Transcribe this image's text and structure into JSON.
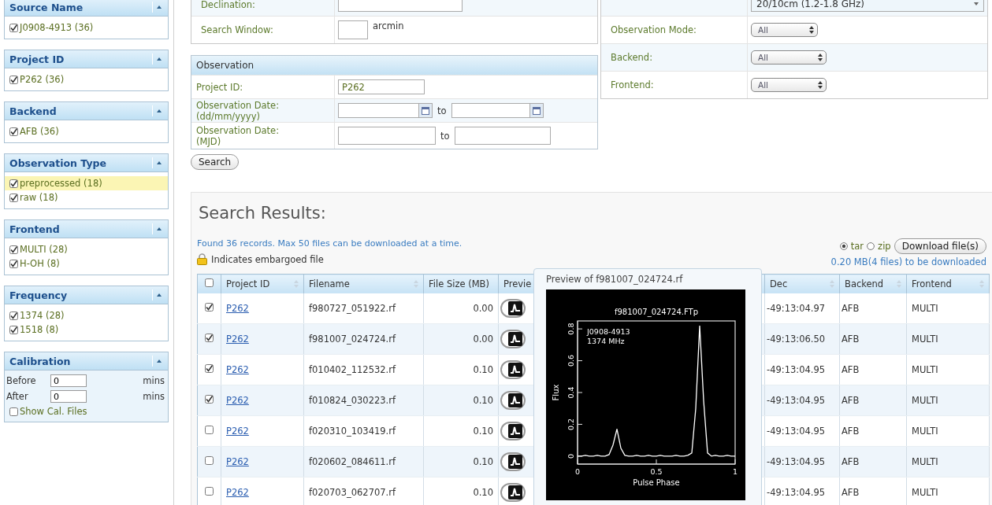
{
  "sidebar": {
    "panels": [
      {
        "title": "Source Name",
        "kind": "checklist",
        "items": [
          {
            "label": "J0908-4913 (36)",
            "checked": true,
            "highlighted": false
          }
        ]
      },
      {
        "title": "Project ID",
        "kind": "checklist",
        "items": [
          {
            "label": "P262 (36)",
            "checked": true,
            "highlighted": false
          }
        ]
      },
      {
        "title": "Backend",
        "kind": "checklist",
        "items": [
          {
            "label": "AFB (36)",
            "checked": true,
            "highlighted": false
          }
        ]
      },
      {
        "title": "Observation Type",
        "kind": "checklist",
        "items": [
          {
            "label": "preprocessed (18)",
            "checked": true,
            "highlighted": true
          },
          {
            "label": "raw (18)",
            "checked": true,
            "highlighted": false
          }
        ]
      },
      {
        "title": "Frontend",
        "kind": "checklist",
        "items": [
          {
            "label": "MULTI (28)",
            "checked": true,
            "highlighted": false
          },
          {
            "label": "H-OH (8)",
            "checked": true,
            "highlighted": false
          }
        ]
      },
      {
        "title": "Frequency",
        "kind": "checklist",
        "items": [
          {
            "label": "1374 (28)",
            "checked": true,
            "highlighted": false
          },
          {
            "label": "1518 (8)",
            "checked": true,
            "highlighted": false
          }
        ]
      },
      {
        "title": "Calibration",
        "kind": "calibration",
        "fields": [
          {
            "label": "Before",
            "value": "0",
            "unit": "mins"
          },
          {
            "label": "After",
            "value": "0",
            "unit": "mins"
          }
        ],
        "option": {
          "label": "Show Cal. Files",
          "checked": false
        }
      }
    ]
  },
  "position_form": {
    "rows": [
      {
        "label": "Declination:",
        "kind": "text"
      },
      {
        "label": "Search Window:",
        "kind": "short",
        "unit": "arcmin"
      }
    ]
  },
  "observation_form": {
    "title": "Observation",
    "rows": [
      {
        "label": "Project ID:",
        "kind": "text",
        "value": "P262"
      },
      {
        "label": "Observation Date: (dd/mm/yyyy)",
        "kind": "date_range",
        "joiner": "to"
      },
      {
        "label": "Observation Date: (MJD)",
        "kind": "range",
        "joiner": "to"
      }
    ]
  },
  "search_button": "Search",
  "filter_form": {
    "rows": [
      {
        "kind": "wide_select",
        "value": "20/10cm (1.2-1.8 GHz)"
      },
      {
        "label": "Observation Mode:",
        "kind": "select",
        "value": "All"
      },
      {
        "label": "Backend:",
        "kind": "select",
        "value": "All"
      },
      {
        "label": "Frontend:",
        "kind": "select",
        "value": "All"
      }
    ]
  },
  "results": {
    "title": "Search Results:",
    "summary": "Found 36 records. Max 50 files can be downloaded at a time.",
    "legend": "Indicates embargoed file",
    "formats": [
      {
        "label": "tar",
        "selected": true
      },
      {
        "label": "zip",
        "selected": false
      }
    ],
    "download_button": "Download file(s)",
    "download_note": "0.20 MB(4 files) to be downloaded",
    "select_all": false,
    "columns": [
      {
        "label": "Project ID",
        "sortable": true
      },
      {
        "label": "Filename",
        "sortable": true
      },
      {
        "label": "File Size (MB)",
        "sortable": false
      },
      {
        "label": "Previe",
        "sortable": false
      },
      {
        "label": "Dec",
        "sortable": true
      },
      {
        "label": "Backend",
        "sortable": true
      },
      {
        "label": "Frontend",
        "sortable": true
      }
    ],
    "rows": [
      {
        "checked": true,
        "project": "P262",
        "filename": "f980727_051922.rf",
        "size": "0.00",
        "dec": "-49:13:04.97",
        "backend": "AFB",
        "frontend": "MULTI"
      },
      {
        "checked": true,
        "project": "P262",
        "filename": "f981007_024724.rf",
        "size": "0.00",
        "dec": "-49:13:06.50",
        "backend": "AFB",
        "frontend": "MULTI"
      },
      {
        "checked": true,
        "project": "P262",
        "filename": "f010402_112532.rf",
        "size": "0.10",
        "dec": "-49:13:04.95",
        "backend": "AFB",
        "frontend": "MULTI"
      },
      {
        "checked": true,
        "project": "P262",
        "filename": "f010824_030223.rf",
        "size": "0.10",
        "dec": "-49:13:04.95",
        "backend": "AFB",
        "frontend": "MULTI"
      },
      {
        "checked": false,
        "project": "P262",
        "filename": "f020310_103419.rf",
        "size": "0.10",
        "dec": "-49:13:04.95",
        "backend": "AFB",
        "frontend": "MULTI"
      },
      {
        "checked": false,
        "project": "P262",
        "filename": "f020602_084611.rf",
        "size": "0.10",
        "dec": "-49:13:04.95",
        "backend": "AFB",
        "frontend": "MULTI"
      },
      {
        "checked": false,
        "project": "P262",
        "filename": "f020703_062707.rf",
        "size": "0.10",
        "dec": "-49:13:04.95",
        "backend": "AFB",
        "frontend": "MULTI"
      }
    ],
    "preview": {
      "title": "Preview of f981007_024724.rf",
      "chart_data": {
        "type": "line",
        "title": "f981007_024724.FTp",
        "xlabel": "Pulse Phase",
        "ylabel": "Flux",
        "x": [
          0,
          0.025,
          0.05,
          0.075,
          0.1,
          0.125,
          0.15,
          0.175,
          0.2,
          0.225,
          0.25,
          0.275,
          0.3,
          0.325,
          0.35,
          0.375,
          0.4,
          0.425,
          0.45,
          0.475,
          0.5,
          0.525,
          0.55,
          0.575,
          0.6,
          0.625,
          0.65,
          0.675,
          0.7,
          0.725,
          0.75,
          0.775,
          0.8,
          0.825,
          0.85,
          0.875,
          0.9,
          0.925,
          0.95,
          0.975,
          1
        ],
        "series": [
          {
            "color": "#ffffff",
            "values": [
              0,
              0,
              0.005,
              0,
              0,
              0.005,
              0,
              0,
              0.01,
              0.07,
              0.17,
              0.05,
              0.005,
              0,
              0,
              0.005,
              0,
              0,
              0.005,
              0,
              0,
              0.005,
              0,
              0,
              0,
              0.005,
              0,
              0,
              0.005,
              0.02,
              0.3,
              0.82,
              0.35,
              0.02,
              0,
              0.005,
              0,
              0,
              0.005,
              0,
              0
            ]
          }
        ],
        "xlim": [
          0,
          1
        ],
        "ylim": [
          -0.05,
          0.85
        ],
        "xticks": [
          0,
          0.5,
          1
        ],
        "yticks": [
          0,
          0.2,
          0.4,
          0.6,
          0.8
        ],
        "annotations": [
          "J0908-4913",
          "1374 MHz"
        ]
      }
    }
  }
}
